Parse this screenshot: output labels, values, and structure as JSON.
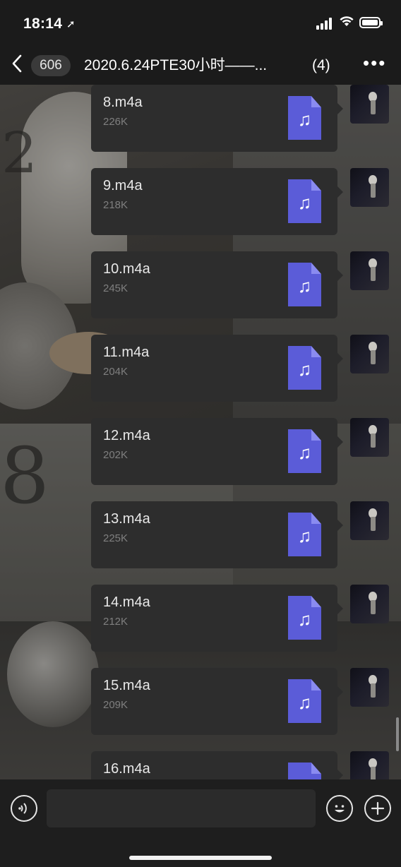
{
  "status_bar": {
    "time": "18:14",
    "location_icon": "location-arrow-icon"
  },
  "nav": {
    "back_icon": "chevron-left-icon",
    "unread_count": "606",
    "title": "2020.6.24PTE30小时——...",
    "member_count": "(4)",
    "more_icon": "more-horizontal-icon"
  },
  "messages": [
    {
      "name": "8.m4a",
      "size": "226K"
    },
    {
      "name": "9.m4a",
      "size": "218K"
    },
    {
      "name": "10.m4a",
      "size": "245K"
    },
    {
      "name": "11.m4a",
      "size": "204K"
    },
    {
      "name": "12.m4a",
      "size": "202K"
    },
    {
      "name": "13.m4a",
      "size": "225K"
    },
    {
      "name": "14.m4a",
      "size": "212K"
    },
    {
      "name": "15.m4a",
      "size": "209K"
    },
    {
      "name": "16.m4a",
      "size": ""
    }
  ],
  "input_bar": {
    "voice_icon": "voice-icon",
    "emoji_icon": "emoji-icon",
    "plus_icon": "plus-icon",
    "text_value": ""
  },
  "colors": {
    "file_icon": "#5b5cd8",
    "bubble": "#2d2d2d",
    "background": "#1b1b1b"
  }
}
